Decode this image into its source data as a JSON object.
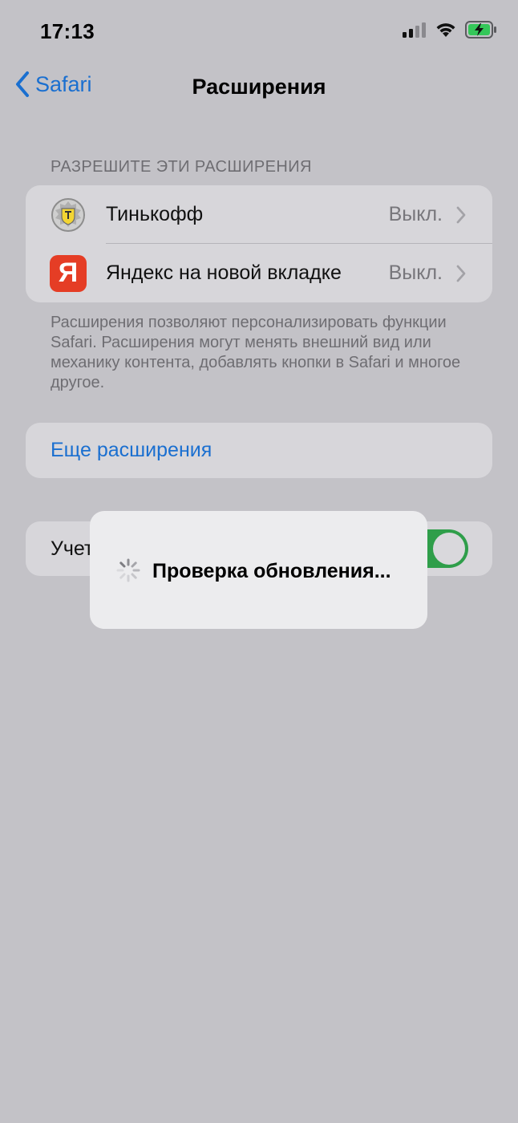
{
  "status_bar": {
    "time": "17:13",
    "signal_icon": "signal-icon",
    "wifi_icon": "wifi-icon",
    "battery_icon": "battery-charging-icon",
    "battery_color": "#34c759"
  },
  "nav": {
    "back_label": "Safari",
    "title": "Расширения"
  },
  "extensions": {
    "header": "РАЗРЕШИТЕ ЭТИ РАСШИРЕНИЯ",
    "items": [
      {
        "label": "Тинькофф",
        "value": "Выкл.",
        "icon": "tinkoff-logo-icon"
      },
      {
        "label": "Яндекс на новой вкладке",
        "value": "Выкл.",
        "icon": "yandex-logo-icon",
        "icon_letter": "Я",
        "icon_color": "#e53d25"
      }
    ],
    "footer": "Расширения позволяют персонализировать функции Safari. Расширения могут менять внешний вид или механику контента, добавлять кнопки в Safari и многое другое."
  },
  "more_extensions": {
    "label": "Еще расширения"
  },
  "sync": {
    "label": "Учет",
    "toggle_on": true,
    "toggle_color": "#34c759"
  },
  "hud": {
    "text": "Проверка обновления...",
    "spinner_icon": "activity-spinner-icon"
  },
  "colors": {
    "accent": "#1a6fd0",
    "background": "#c3c2c7"
  }
}
